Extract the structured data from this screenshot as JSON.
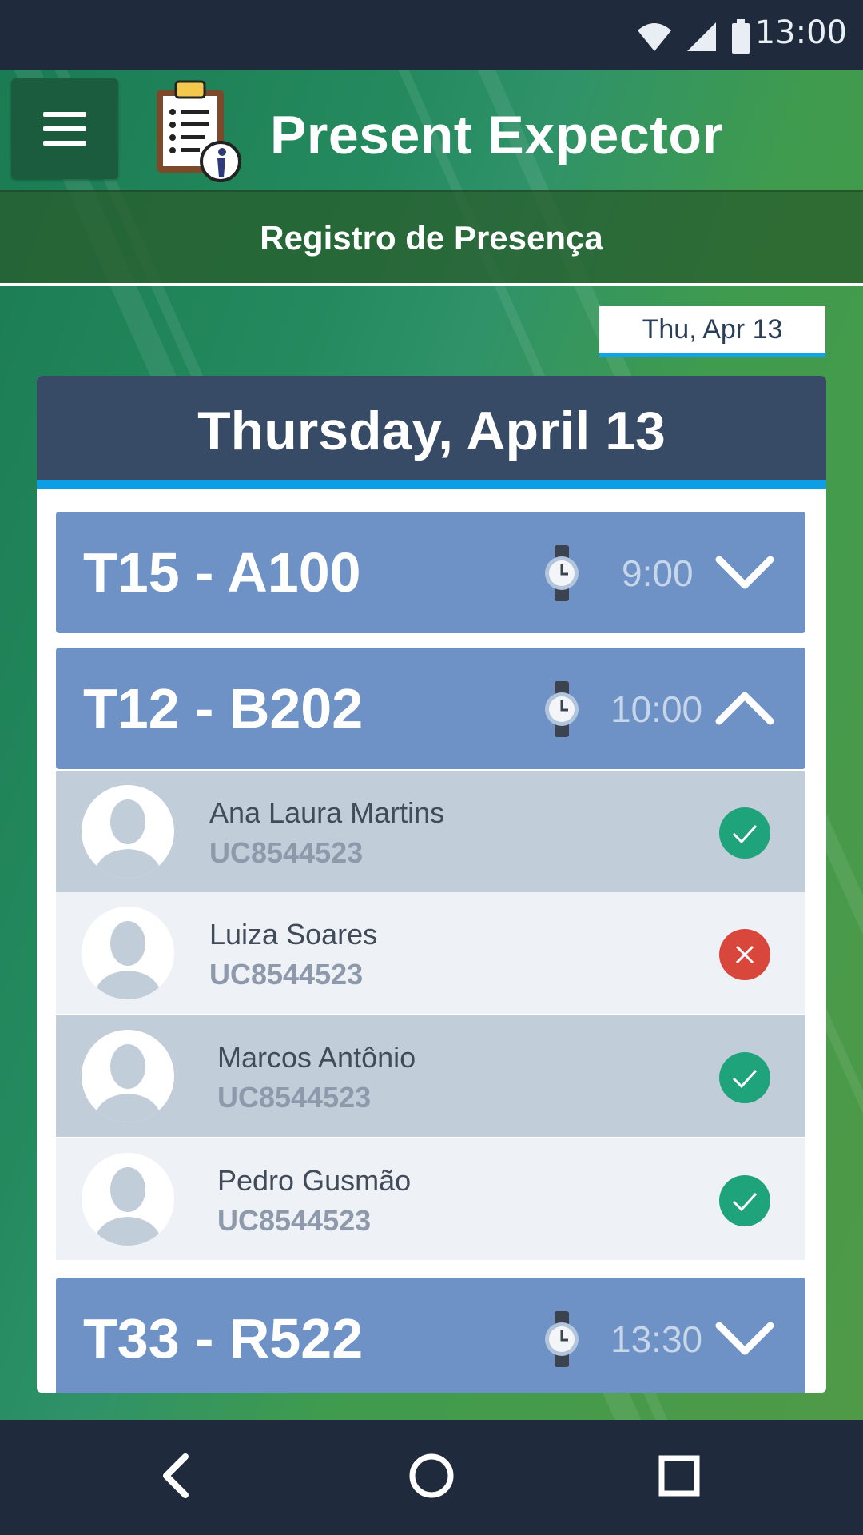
{
  "status_bar": {
    "time": "13:00",
    "icons": [
      "wifi-icon",
      "signal-icon",
      "battery-icon"
    ]
  },
  "app": {
    "title": "Present Expector",
    "subtitle": "Registro de Presença"
  },
  "date_chip": {
    "label": "Thu, Apr 13"
  },
  "card": {
    "title": "Thursday, April 13"
  },
  "classes": [
    {
      "name": "T15 - A100",
      "time": "9:00",
      "expanded": false
    },
    {
      "name": "T12 - B202",
      "time": "10:00",
      "expanded": true
    },
    {
      "name": "T33 - R522",
      "time": "13:30",
      "expanded": false
    }
  ],
  "students": [
    {
      "name": "Ana Laura Martins",
      "id": "UC8544523",
      "present": true
    },
    {
      "name": "Luiza Soares",
      "id": "UC8544523",
      "present": false
    },
    {
      "name": "Marcos Antônio",
      "id": "UC8544523",
      "present": true
    },
    {
      "name": "Pedro Gusmão",
      "id": "UC8544523",
      "present": true
    }
  ],
  "colors": {
    "accent": "#0d9ee6",
    "card_header": "#374a66",
    "class_row": "#6e92c6",
    "present": "#1ea37a",
    "absent": "#d9473c"
  },
  "nav": {
    "icons": [
      "back-icon",
      "home-icon",
      "recents-icon"
    ]
  }
}
